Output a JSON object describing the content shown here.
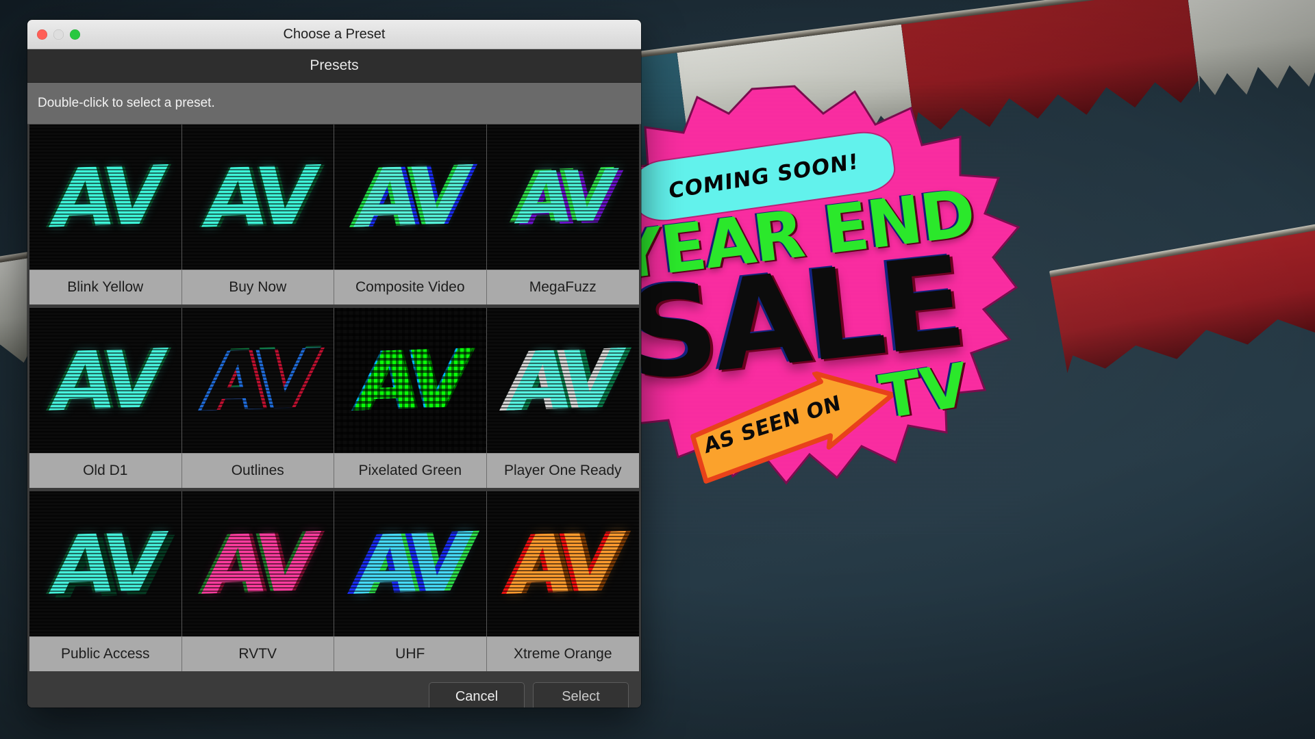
{
  "window": {
    "title": "Choose a Preset",
    "traffic_lights": [
      "close-button",
      "minimize-button",
      "zoom-button"
    ],
    "section_header": "Presets",
    "hint": "Double-click to select a preset.",
    "colors": {
      "titlebar_top": "#ececec",
      "titlebar_bottom": "#d6d6d6",
      "section_header_bg": "#2e2e2e",
      "hint_bg": "#6a6a6a",
      "body_bg": "#3b3b3b",
      "label_bg": "#aaaaaa",
      "thumb_bg": "#0b0b0b"
    }
  },
  "presets": {
    "rows": [
      [
        {
          "label": "Blink Yellow",
          "ink": "#3DF5D8",
          "ghost_a": "#0a4e2a",
          "ghost_b": "#0a4e2a"
        },
        {
          "label": "Buy Now",
          "ink": "#3DF5D8",
          "ghost_a": "#0a4e2a",
          "ghost_b": "#0a4e2a"
        },
        {
          "label": "Composite Video",
          "ink": "#55F0D8",
          "ghost_a": "#23e04a",
          "ghost_b": "#1a2df0"
        },
        {
          "label": "MegaFuzz",
          "ink": "#4BF0D6",
          "ghost_a": "#2ee04a",
          "ghost_b": "#6a12c8"
        }
      ],
      [
        {
          "label": "Old D1",
          "ink": "#46F2DC",
          "ghost_a": "#0c5a2e",
          "ghost_b": "#0c5a2e"
        },
        {
          "label": "Outlines",
          "ink": "#0d0d0d",
          "ghost_a": "#1f6bd8",
          "ghost_b": "#c01030"
        },
        {
          "label": "Pixelated Green",
          "ink": "#2BE82B",
          "ghost_a": "#1aa6d8",
          "ghost_b": "#107a10"
        },
        {
          "label": "Player One Ready",
          "ink": "#55F2E0",
          "ghost_a": "#d8d8d8",
          "ghost_b": "#0b7a4a"
        }
      ],
      [
        {
          "label": "Public Access",
          "ink": "#44F0DA",
          "ghost_a": "#0d4f2c",
          "ghost_b": "#0d4f2c"
        },
        {
          "label": "RVTV",
          "ink": "#FF3C9E",
          "ghost_a": "#1f7a2a",
          "ghost_b": "#7a1030"
        },
        {
          "label": "UHF",
          "ink": "#45D8F5",
          "ghost_a": "#1a2df0",
          "ghost_b": "#2ee04a"
        },
        {
          "label": "Xtreme Orange",
          "ink": "#FF9B2E",
          "ghost_a": "#f01010",
          "ghost_b": "#7a3a05"
        }
      ]
    ],
    "thumbnail_glyph": "AV"
  },
  "footer": {
    "cancel_label": "Cancel",
    "select_label": "Select"
  },
  "backdrop": {
    "scene": "carnival-banner-flags-over-dark-blue-sky",
    "sky_color": "#21323c",
    "flag_colors": [
      "#2f6b7d",
      "#cfd2cb",
      "#9b1f23"
    ]
  },
  "sale_graphic": {
    "banner_text": "COMING SOON!",
    "headline": "YEAR END",
    "subheadline": "SALE",
    "arrow_text": "AS SEEN ON",
    "tv_text": "TV",
    "colors": {
      "burst": "#F92CA0",
      "banner": "#62F2EC",
      "headline": "#2BE82B",
      "subheadline": "#0C0C0C",
      "arrow": "#FBA22C",
      "arrow_shadow": "#E8421A"
    }
  }
}
